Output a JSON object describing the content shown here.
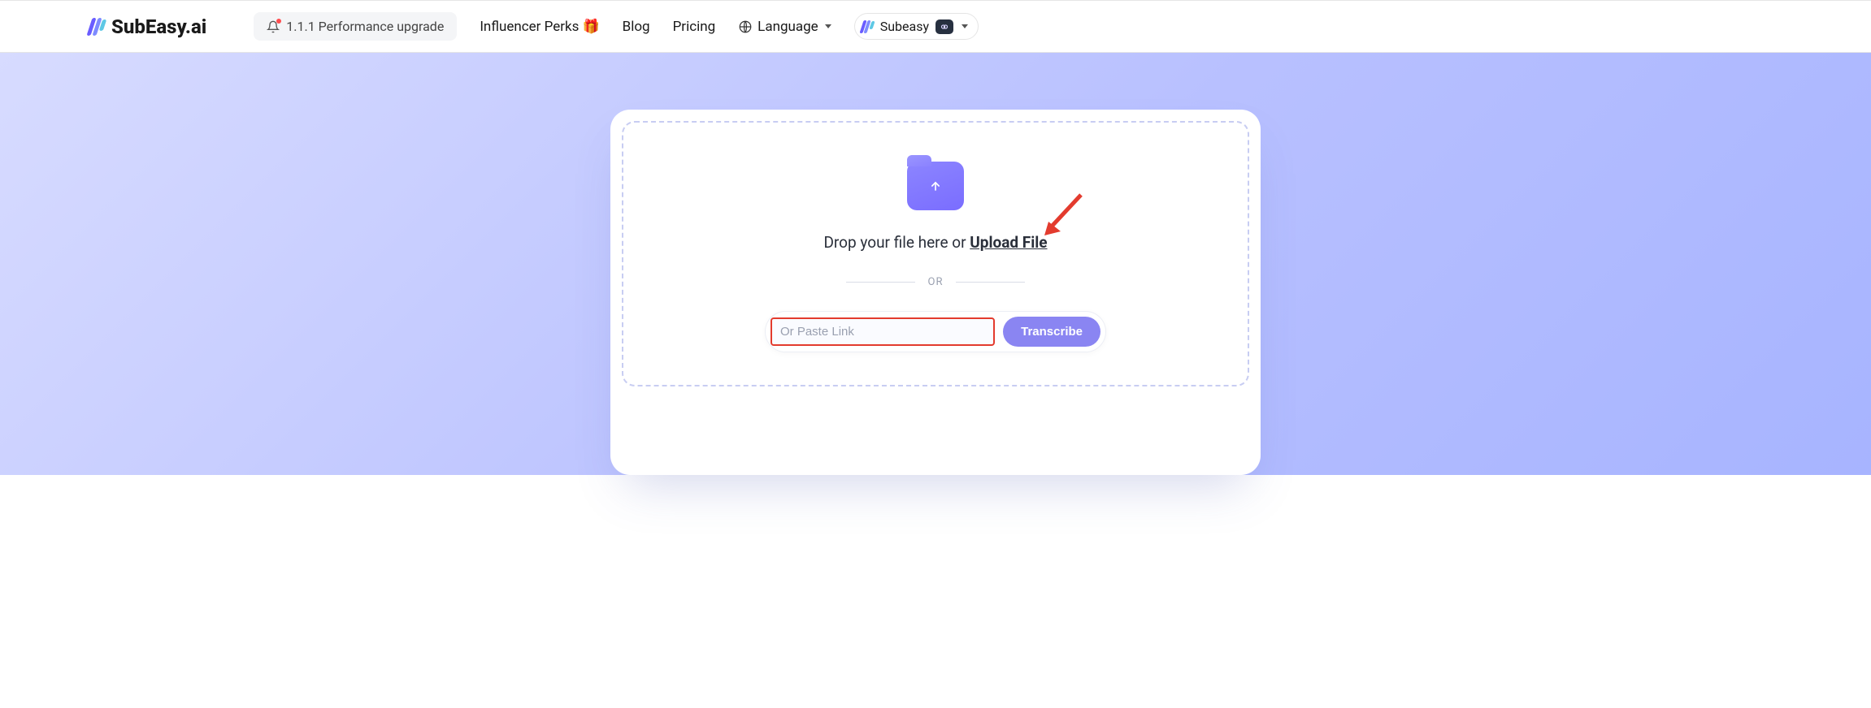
{
  "header": {
    "brand": "SubEasy.ai",
    "update_text": "1.1.1 Performance upgrade",
    "nav": {
      "influencer": "Influencer Perks",
      "blog": "Blog",
      "pricing": "Pricing",
      "language_label": "Language"
    },
    "user": {
      "name": "Subeasy"
    }
  },
  "upload": {
    "drop_prefix": "Drop your file here or ",
    "upload_link": "Upload File",
    "or_label": "OR",
    "link_placeholder": "Or Paste Link",
    "transcribe_label": "Transcribe"
  }
}
